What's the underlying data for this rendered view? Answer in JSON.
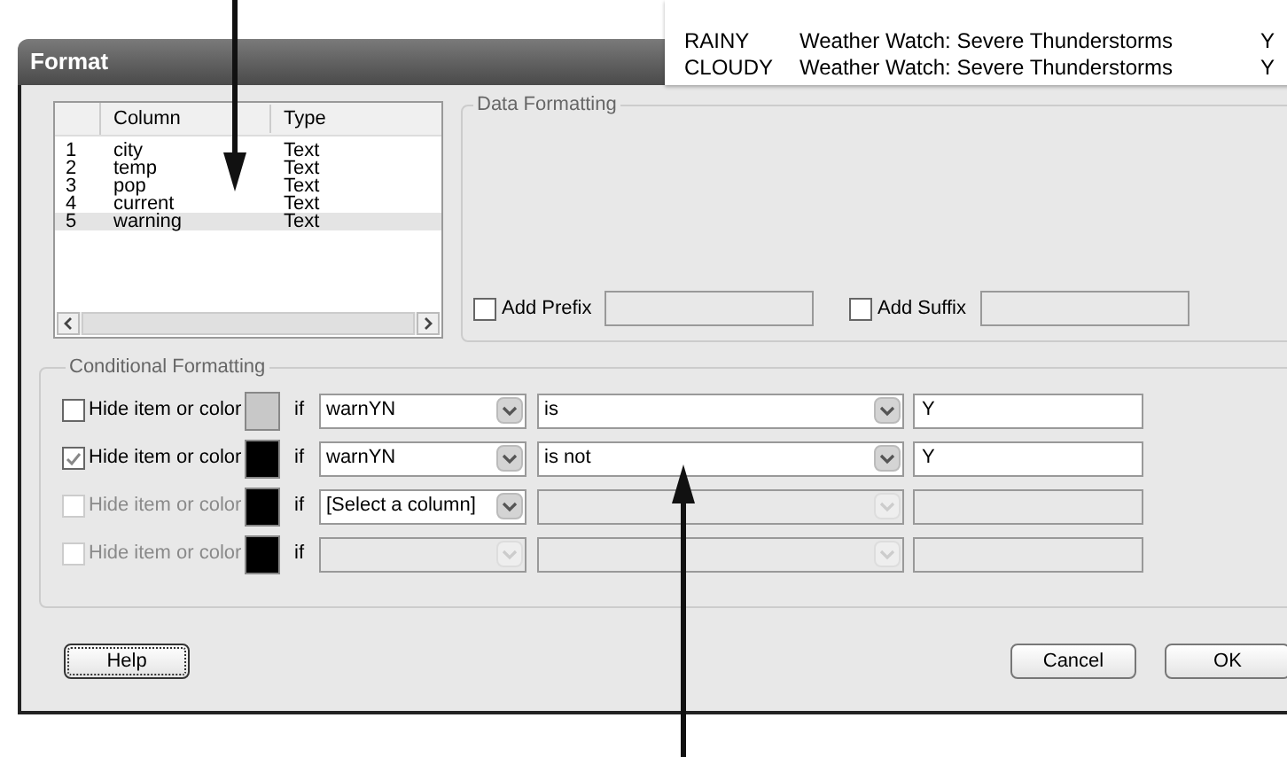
{
  "background_table": {
    "rows": [
      {
        "column_1": "RAINY",
        "column_2": "Weather Watch: Severe Thunderstorms",
        "column_3": "Y"
      },
      {
        "column_1": "CLOUDY",
        "column_2": "Weather Watch: Severe Thunderstorms",
        "column_3": "Y"
      }
    ]
  },
  "window": {
    "title": "Format"
  },
  "column_list": {
    "columns": [
      "Column",
      "Type"
    ],
    "rows": [
      {
        "number": "1",
        "name": "city",
        "type": "Text",
        "selected": false
      },
      {
        "number": "2",
        "name": "temp",
        "type": "Text",
        "selected": false
      },
      {
        "number": "3",
        "name": "pop",
        "type": "Text",
        "selected": false
      },
      {
        "number": "4",
        "name": "current",
        "type": "Text",
        "selected": false
      },
      {
        "number": "5",
        "name": "warning",
        "type": "Text",
        "selected": true
      }
    ]
  },
  "data_formatting": {
    "title": "Data Formatting",
    "options": [
      {
        "label": "Add Prefix",
        "checked": false
      },
      {
        "label": "Add Suffix",
        "checked": false
      }
    ]
  },
  "conditional_formatting": {
    "title": "Conditional Formatting",
    "rules": [
      {
        "label": "Hide item or color",
        "checked": false,
        "disabled": false,
        "color": "#c8c8c8",
        "if_label": "if",
        "column": "warnYN",
        "column_disabled": false,
        "operator": "is",
        "value": "Y"
      },
      {
        "label": "Hide item or color",
        "checked": true,
        "disabled": false,
        "color": "#000000",
        "if_label": "if",
        "column": "warnYN",
        "column_disabled": false,
        "operator": "is not",
        "value": "Y"
      },
      {
        "label": "Hide item or color",
        "checked": false,
        "disabled": true,
        "color": "#000000",
        "if_label": "if",
        "column": "[Select a column]",
        "column_disabled": false
      },
      {
        "label": "Hide item or color",
        "checked": false,
        "disabled": true,
        "color": "#000000",
        "if_label": "if",
        "column_disabled": true
      }
    ]
  },
  "buttons": [
    {
      "label": "Help",
      "focused": true
    },
    {
      "label": "Cancel",
      "focused": false
    },
    {
      "label": "OK",
      "focused": false
    }
  ]
}
